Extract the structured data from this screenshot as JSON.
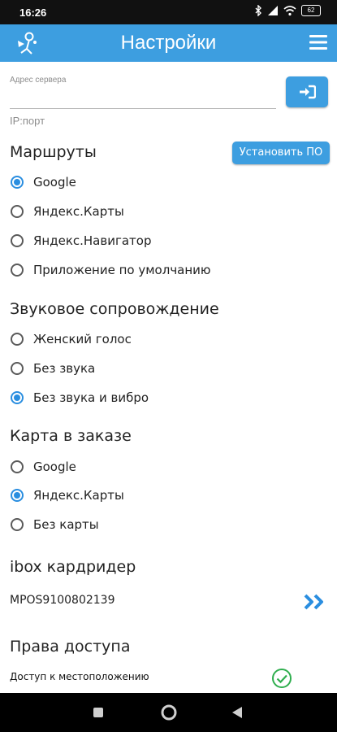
{
  "status_bar": {
    "time": "16:26",
    "battery": "62"
  },
  "header": {
    "title": "Настройки",
    "logo_icon": "app-logo-icon",
    "menu_icon": "hamburger-menu-icon"
  },
  "server": {
    "label": "Адрес сервера",
    "value": "",
    "hint": "IP:порт",
    "login_icon": "login-icon"
  },
  "routes": {
    "title": "Маршруты",
    "install_label": "Установить ПО",
    "options": [
      {
        "label": "Google",
        "checked": true
      },
      {
        "label": "Яндекс.Карты",
        "checked": false
      },
      {
        "label": "Яндекс.Навигатор",
        "checked": false
      },
      {
        "label": "Приложение по умолчанию",
        "checked": false
      }
    ]
  },
  "sound": {
    "title": "Звуковое сопровождение",
    "options": [
      {
        "label": "Женский голос",
        "checked": false
      },
      {
        "label": "Без звука",
        "checked": false
      },
      {
        "label": "Без звука и вибро",
        "checked": true
      }
    ]
  },
  "order_map": {
    "title": "Карта в заказе",
    "options": [
      {
        "label": "Google",
        "checked": false
      },
      {
        "label": "Яндекс.Карты",
        "checked": true
      },
      {
        "label": "Без карты",
        "checked": false
      }
    ]
  },
  "cardreader": {
    "title": "ibox кардридер",
    "device": "MPOS9100802139",
    "arrow_icon": "double-chevron-right-icon"
  },
  "permissions": {
    "title": "Права доступа",
    "location_label": "Доступ к местоположению",
    "location_granted": true
  },
  "nav_bar": {
    "icons": [
      "square-icon",
      "circle-home-icon",
      "triangle-back-icon"
    ]
  },
  "colors": {
    "accent": "#3d9ee0",
    "radio_checked": "#2a8ee0",
    "check_green": "#2fae4e"
  }
}
